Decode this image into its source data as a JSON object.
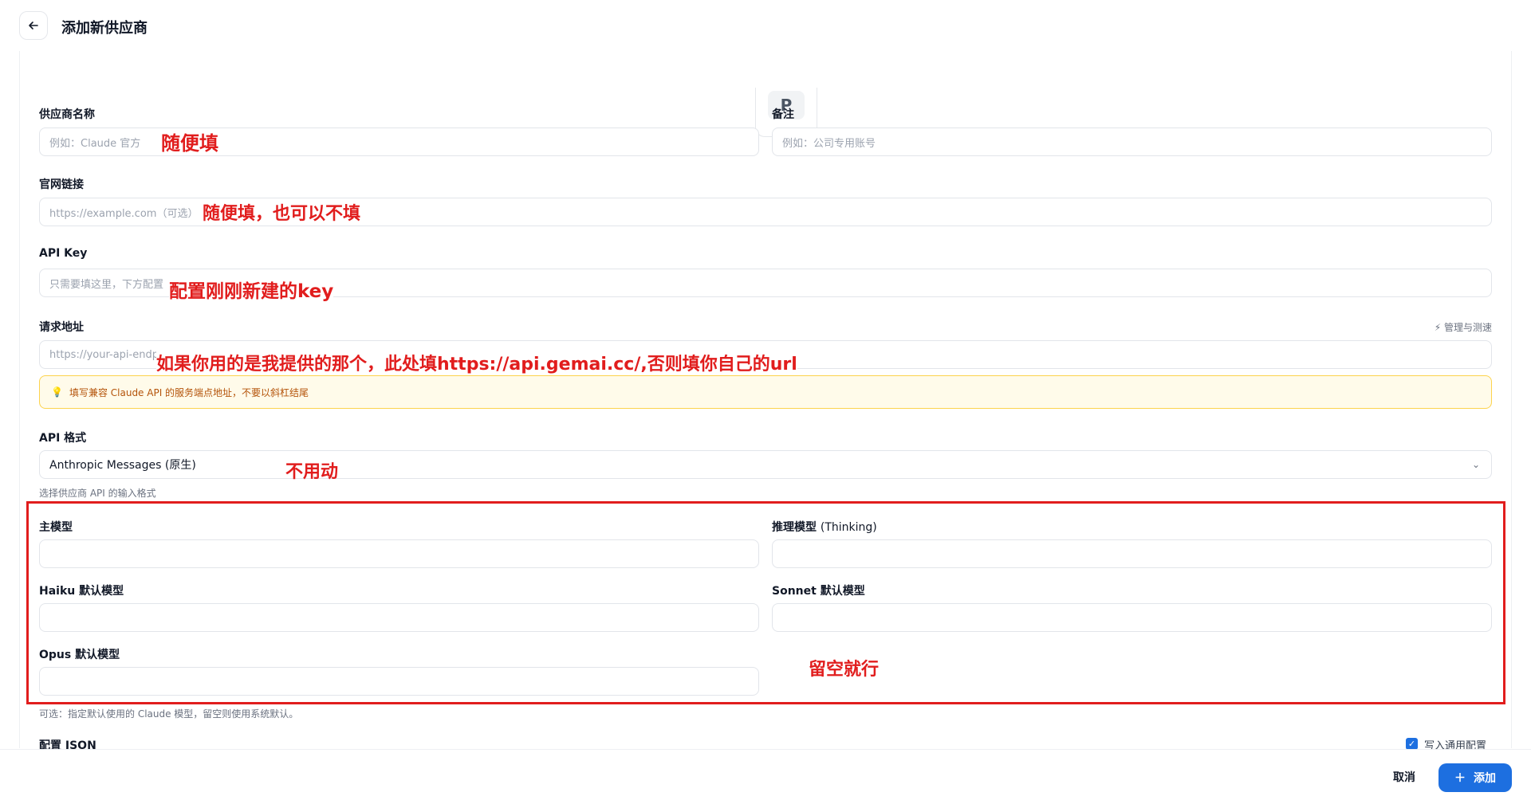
{
  "header": {
    "title": "添加新供应商"
  },
  "avatar": {
    "letter": "P"
  },
  "fields": {
    "name": {
      "label": "供应商名称",
      "placeholder": "例如：Claude 官方"
    },
    "note": {
      "label": "备注",
      "placeholder": "例如：公司专用账号"
    },
    "website": {
      "label": "官网链接",
      "placeholder": "https://example.com（可选）"
    },
    "api_key": {
      "label": "API Key",
      "placeholder": "只需要填这里，下方配置"
    },
    "endpoint": {
      "label": "请求地址",
      "placeholder": "https://your-api-endp",
      "manage_label": "管理与测速",
      "hint": "填写兼容 Claude API 的服务端点地址，不要以斜杠结尾"
    },
    "api_format": {
      "label": "API 格式",
      "value": "Anthropic Messages (原生)",
      "helper": "选择供应商 API 的输入格式"
    },
    "main_model": {
      "label": "主模型"
    },
    "thinking_model": {
      "label": "推理模型",
      "label_suffix": "(Thinking)"
    },
    "haiku_model": {
      "label": "Haiku 默认模型"
    },
    "sonnet_model": {
      "label": "Sonnet 默认模型"
    },
    "opus_model": {
      "label": "Opus 默认模型"
    },
    "models_helper": "可选：指定默认使用的 Claude 模型，留空则使用系统默认。",
    "config_json": {
      "label": "配置 JSON",
      "checkbox_label": "写入通用配置",
      "checked": true
    }
  },
  "footer": {
    "cancel_label": "取消",
    "add_label": "添加"
  },
  "annotations": {
    "name": "随便填",
    "website": "随便填，也可以不填",
    "api_key": "配置刚刚新建的key",
    "endpoint": "如果你用的是我提供的那个，此处填https://api.gemai.cc/,否则填你自己的url",
    "api_format": "不用动",
    "models": "留空就行"
  },
  "colors": {
    "accent": "#1d6fe0",
    "annotation": "#e11d1d",
    "hint_bg": "#fffbea",
    "hint_border": "#fcd34d"
  }
}
